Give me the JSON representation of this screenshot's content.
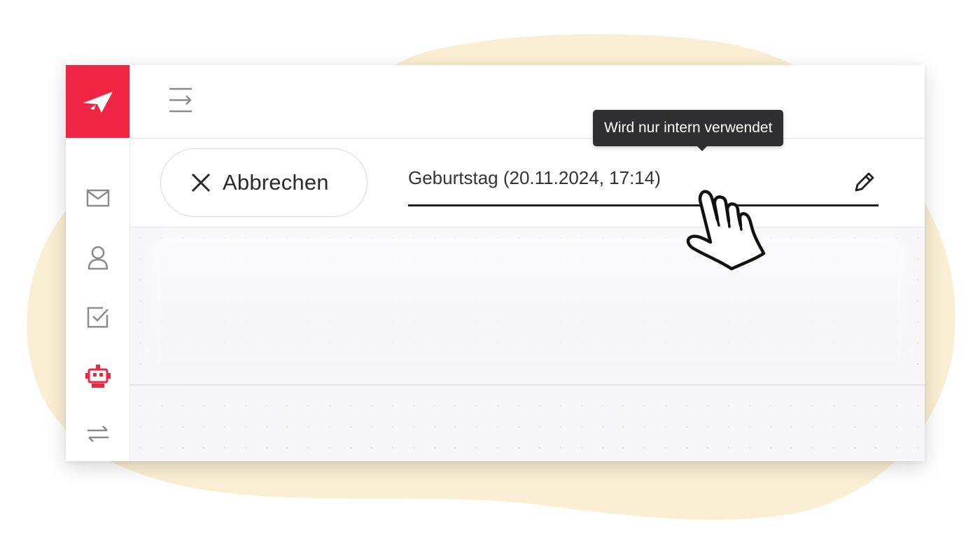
{
  "colors": {
    "brand_red": "#f02543",
    "blob_beige": "#fbefd3",
    "tooltip_bg": "#2f2f31",
    "field_underline": "#1f1f23",
    "icon_gray": "#8a8a90"
  },
  "sidebar": {
    "logo_icon": "paper-plane-icon",
    "items": [
      {
        "icon": "mail-icon",
        "active": false
      },
      {
        "icon": "user-icon",
        "active": false
      },
      {
        "icon": "checkbox-icon",
        "active": false
      },
      {
        "icon": "robot-icon",
        "active": true
      },
      {
        "icon": "transfer-arrows-icon",
        "active": false
      }
    ]
  },
  "topbar": {
    "menu_icon": "menu-toggle-icon"
  },
  "toolbar": {
    "cancel_label": "Abbrechen",
    "cancel_icon": "close-icon",
    "name_value": "Geburtstag (20.11.2024, 17:14)",
    "edit_icon": "pencil-icon"
  },
  "tooltip": {
    "text": "Wird nur intern verwendet"
  },
  "pointer": {
    "icon": "hand-pointer-icon"
  }
}
